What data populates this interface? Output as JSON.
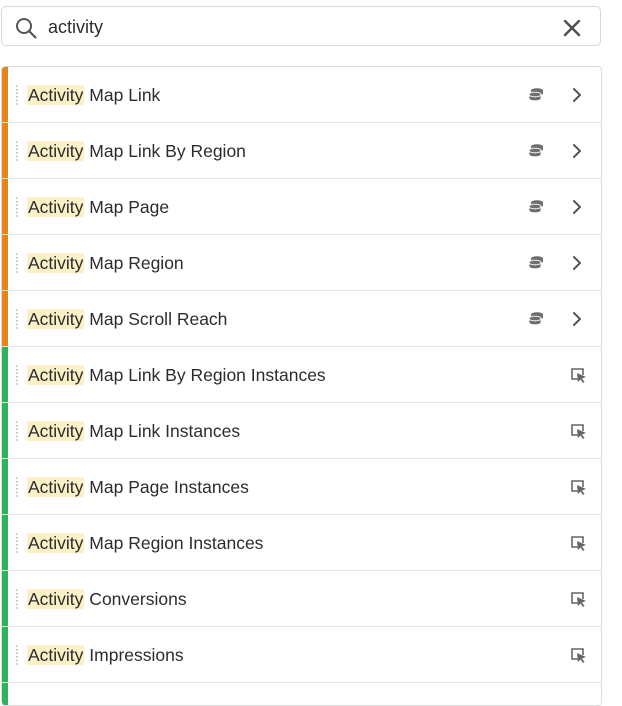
{
  "search": {
    "value": "activity"
  },
  "colors": {
    "dimension": "#e68619",
    "metric": "#2fb45a",
    "highlight": "#fbf0c6"
  },
  "items": [
    {
      "highlight": "Activity",
      "rest": " Map Link",
      "kind": "dimension",
      "icons": [
        "dataset-icon",
        "chevron-right-icon"
      ]
    },
    {
      "highlight": "Activity",
      "rest": " Map Link By Region",
      "kind": "dimension",
      "icons": [
        "dataset-icon",
        "chevron-right-icon"
      ]
    },
    {
      "highlight": "Activity",
      "rest": " Map Page",
      "kind": "dimension",
      "icons": [
        "dataset-icon",
        "chevron-right-icon"
      ]
    },
    {
      "highlight": "Activity",
      "rest": " Map Region",
      "kind": "dimension",
      "icons": [
        "dataset-icon",
        "chevron-right-icon"
      ]
    },
    {
      "highlight": "Activity",
      "rest": " Map Scroll Reach",
      "kind": "dimension",
      "icons": [
        "dataset-icon",
        "chevron-right-icon"
      ]
    },
    {
      "highlight": "Activity",
      "rest": " Map Link By Region Instances",
      "kind": "metric",
      "icons": [
        "event-pointer-icon"
      ]
    },
    {
      "highlight": "Activity",
      "rest": " Map Link Instances",
      "kind": "metric",
      "icons": [
        "event-pointer-icon"
      ]
    },
    {
      "highlight": "Activity",
      "rest": " Map Page Instances",
      "kind": "metric",
      "icons": [
        "event-pointer-icon"
      ]
    },
    {
      "highlight": "Activity",
      "rest": " Map Region Instances",
      "kind": "metric",
      "icons": [
        "event-pointer-icon"
      ]
    },
    {
      "highlight": "Activity",
      "rest": " Conversions",
      "kind": "metric",
      "icons": [
        "event-pointer-icon"
      ]
    },
    {
      "highlight": "Activity",
      "rest": " Impressions",
      "kind": "metric",
      "icons": [
        "event-pointer-icon"
      ]
    },
    {
      "highlight": "",
      "rest": "",
      "kind": "metric",
      "icons": []
    }
  ]
}
